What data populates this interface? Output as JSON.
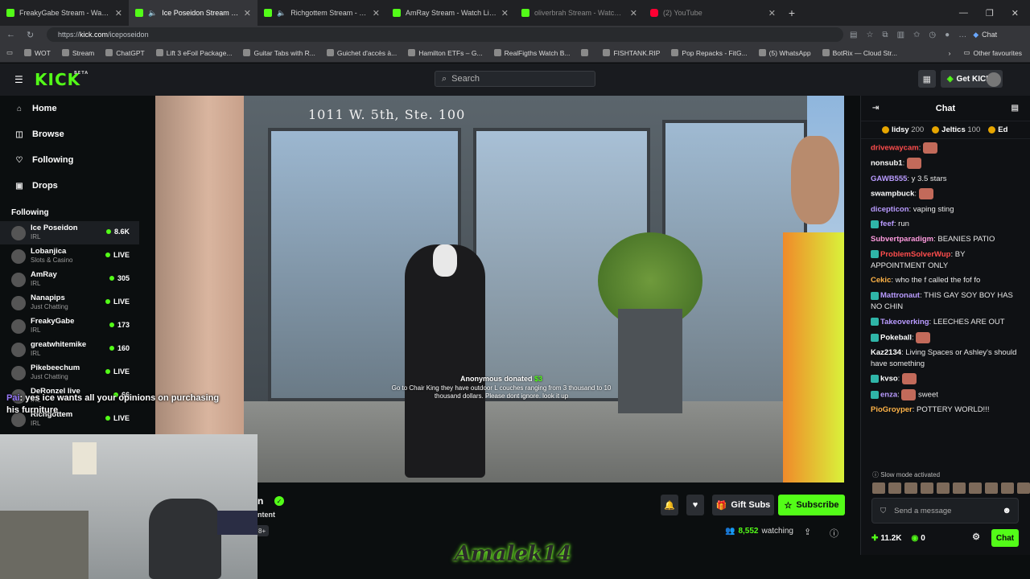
{
  "tabs": [
    {
      "title": "FreakyGabe Stream - Watch L",
      "active": false
    },
    {
      "title": "Ice Poseidon Stream - Watch",
      "active": true
    },
    {
      "title": "Richgottem Stream - Watch L",
      "active": false
    },
    {
      "title": "AmRay Stream - Watch Live o",
      "active": false
    },
    {
      "title": "oliverbrah Stream - Watch Live on",
      "active": false
    },
    {
      "title": "(2) YouTube",
      "active": false
    }
  ],
  "address": {
    "prefix": "https://",
    "host": "kick.com",
    "path": "/iceposeidon"
  },
  "copilot_label": "Chat",
  "bookmarks": [
    "WOT",
    "Stream",
    "ChatGPT",
    "Lift 3 eFoil Package...",
    "Guitar Tabs with R...",
    "Guichet d'accès à...",
    "Hamilton ETFs – G...",
    "RealFigths Watch B...",
    "",
    "FISHTANK.RIP",
    "Pop Repacks - FitG...",
    "(5) WhatsApp",
    "BotRix — Cloud Str..."
  ],
  "other_favourites": "Other favourites",
  "header": {
    "logo": "KICK",
    "logo_tag": "BETA",
    "search_placeholder": "Search",
    "get_kicks": "Get KICKs"
  },
  "nav": [
    "Home",
    "Browse",
    "Following",
    "Drops"
  ],
  "following_title": "Following",
  "channels": [
    {
      "name": "Ice Poseidon",
      "cat": "IRL",
      "status": "8.6K",
      "highlight": true
    },
    {
      "name": "Lobanjica",
      "cat": "Slots & Casino",
      "status": "LIVE"
    },
    {
      "name": "AmRay",
      "cat": "IRL",
      "status": "305"
    },
    {
      "name": "Nanapips",
      "cat": "Just Chatting",
      "status": "LIVE"
    },
    {
      "name": "FreakyGabe",
      "cat": "IRL",
      "status": "173"
    },
    {
      "name": "greatwhitemike",
      "cat": "IRL",
      "status": "160"
    },
    {
      "name": "Pikebeechum",
      "cat": "Just Chatting",
      "status": "LIVE"
    },
    {
      "name": "DeRonzel live",
      "cat": "IRL",
      "status": "66"
    },
    {
      "name": "Richgottem",
      "cat": "IRL",
      "status": "LIVE"
    }
  ],
  "video": {
    "address_sign": "1011 W. 5th, Ste. 100",
    "donation_name": "Anonymous donated ",
    "donation_amount": "$3",
    "donation_msg": "Go to Chair King they have outdoor L couches ranging from 3 thousand to 10 thousand dollars. Please dont ignore. look it up"
  },
  "below": {
    "name_fragment": "n",
    "sub_fragment": "ntent",
    "age": "8+",
    "gift_subs": "Gift Subs",
    "subscribe": "Subscribe",
    "watching_count": "8,552",
    "watching_label": "watching"
  },
  "cam_chat": {
    "user": "Pai",
    "text": ": yes ice wants all your opinions on purchasing his furniture"
  },
  "watermark": "Amalek14",
  "chat": {
    "title": "Chat",
    "leaders": [
      {
        "name": "lidsy",
        "points": "200"
      },
      {
        "name": "Jeltics",
        "points": "100"
      },
      {
        "name": "Ed",
        "points": ""
      }
    ],
    "messages": [
      {
        "user": "drivewaycam",
        "color": "#ff4d4d",
        "text": "",
        "emote": true
      },
      {
        "user": "nonsub1",
        "color": "#ffffff",
        "text": "",
        "emote": true
      },
      {
        "user": "GAWB555",
        "color": "#b99bff",
        "text": " y 3.5 stars"
      },
      {
        "user": "swampbuck",
        "color": "#ffffff",
        "text": "",
        "emote": true
      },
      {
        "user": "dicepticon",
        "color": "#b99bff",
        "text": " vaping sting"
      },
      {
        "user": "feef",
        "color": "#b99bff",
        "text": " run",
        "badges": true
      },
      {
        "user": "Subvertparadigm",
        "color": "#ff9bde",
        "text": " BEANIES PATIO"
      },
      {
        "user": "ProblemSolverWup",
        "color": "#ff4d4d",
        "text": " BY APPOINTMENT ONLY",
        "badges": true
      },
      {
        "user": "Cekic",
        "color": "#ffb347",
        "text": " who the f called the fof fo"
      },
      {
        "user": "Mattronaut",
        "color": "#b99bff",
        "text": " THIS GAY SOY BOY HAS NO CHIN",
        "badges": true
      },
      {
        "user": "Takeoverking",
        "color": "#b99bff",
        "text": " LEECHES ARE OUT",
        "badges": true
      },
      {
        "user": "Pokeball",
        "color": "#ffffff",
        "text": "",
        "emote": true,
        "badges": true
      },
      {
        "user": "Kaz2134",
        "color": "#ffffff",
        "text": " Living Spaces or Ashley's should have something"
      },
      {
        "user": "kvso",
        "color": "#ffffff",
        "text": "",
        "emote": true,
        "badges": true
      },
      {
        "user": "enza",
        "color": "#b99bff",
        "text": " sweet",
        "emote": true,
        "badges": true
      },
      {
        "user": "PioGroyper",
        "color": "#ffb347",
        "text": " POTTERY WORLD!!!"
      }
    ],
    "slow_mode": "Slow mode activated",
    "input_placeholder": "Send a message",
    "kicks": "11.2K",
    "count2": "0",
    "chat_button": "Chat"
  }
}
